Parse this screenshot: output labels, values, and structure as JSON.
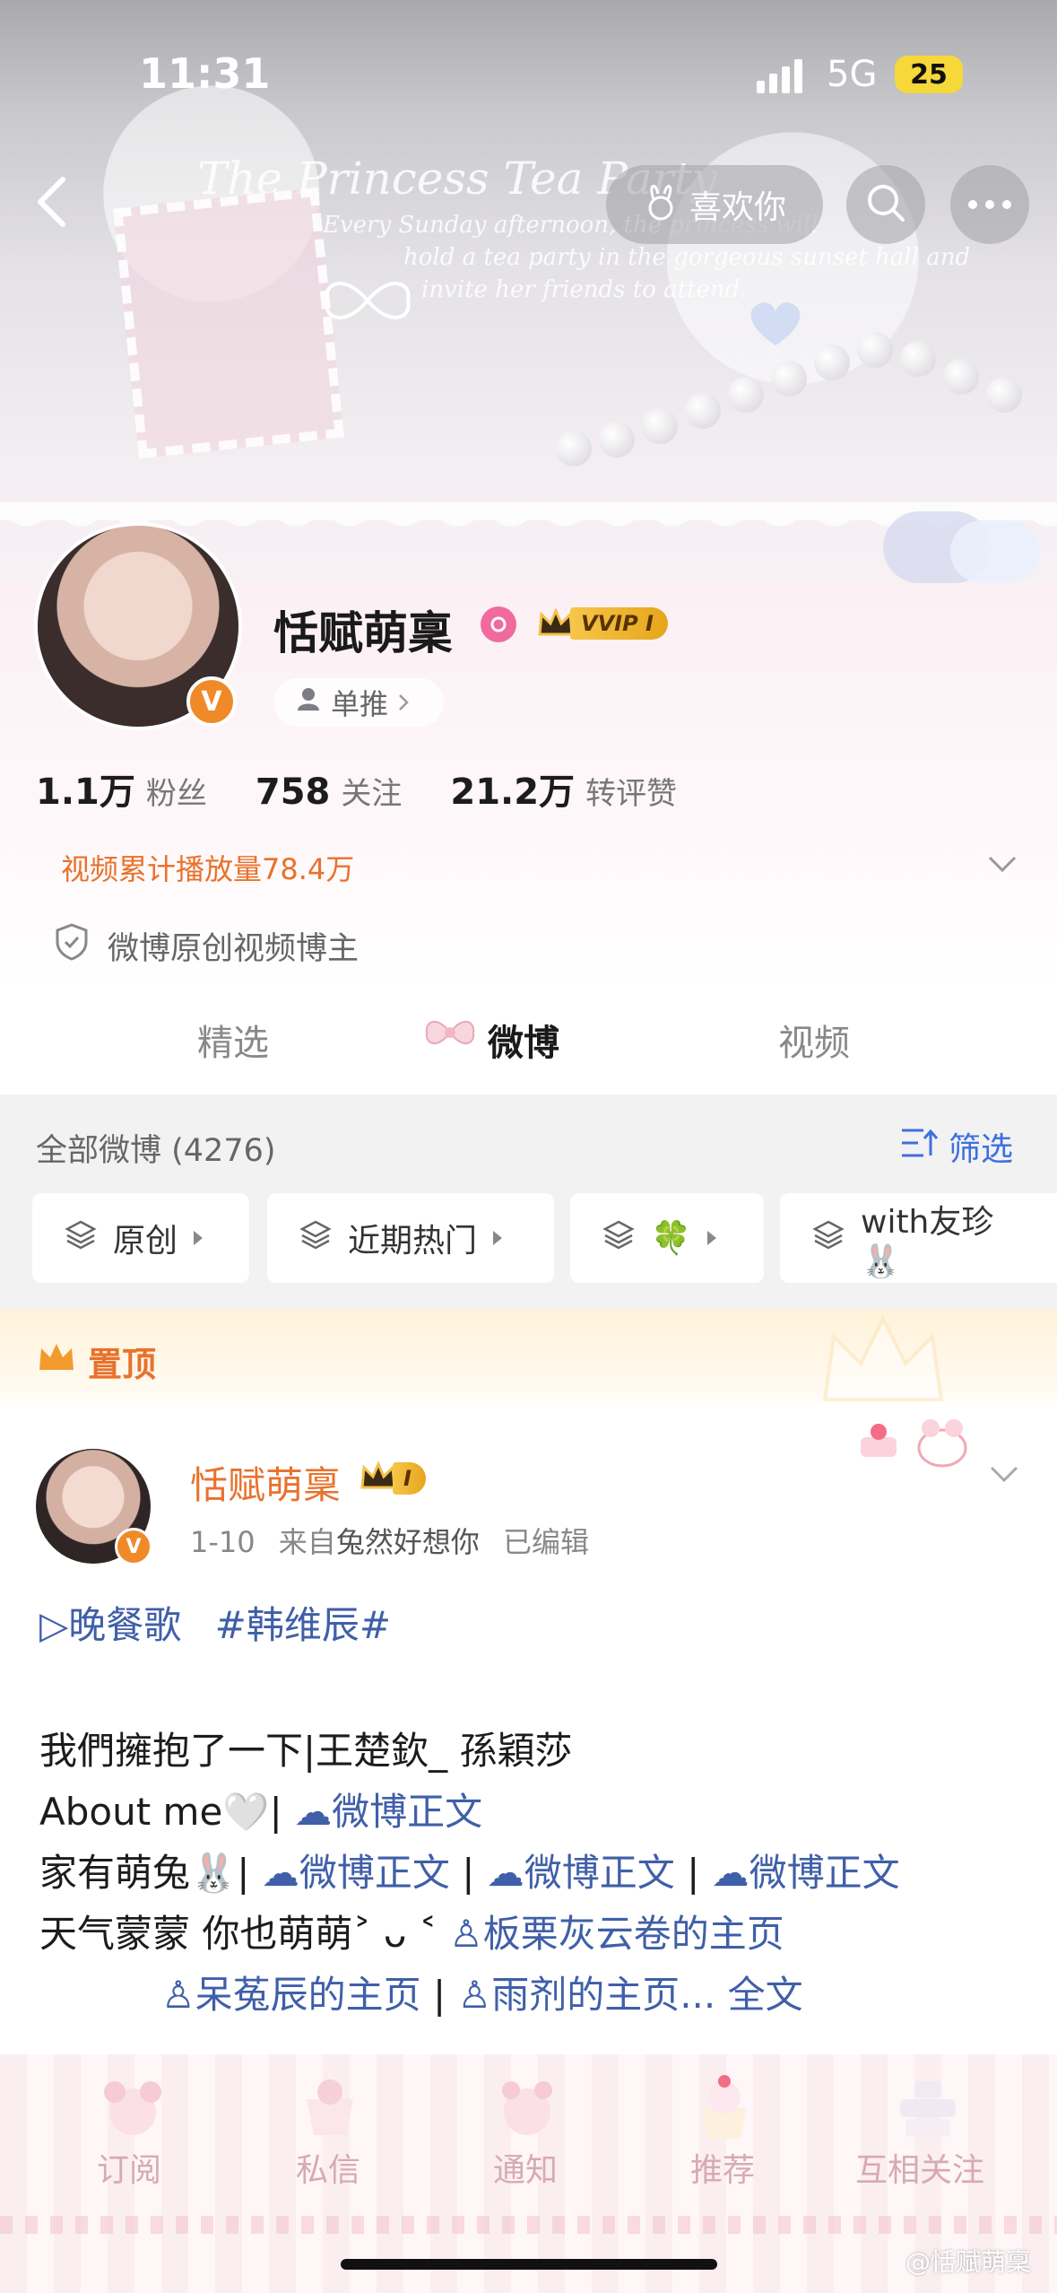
{
  "status_bar": {
    "time": "11:31",
    "network": "5G",
    "battery": "25"
  },
  "banner": {
    "title_line": "The Princess Tea Party",
    "lines": [
      "Every Sunday afternoon, the princess will",
      "hold a tea party in the gorgeous sunset hall and",
      "invite her friends to attend."
    ]
  },
  "nav": {
    "like_label": "喜欢你"
  },
  "profile": {
    "username": "恬赋萌稟",
    "vip_label": "VVIP I",
    "single_push": "单推",
    "stats": [
      {
        "num": "1.1万",
        "label": "粉丝"
      },
      {
        "num": "758",
        "label": "关注"
      },
      {
        "num": "21.2万",
        "label": "转评赞"
      }
    ],
    "video_plays": "视频累计播放量78.4万",
    "creator_label": "微博原创视频博主"
  },
  "tabs": [
    "精选",
    "微博",
    "视频"
  ],
  "filter": {
    "all_posts": "全部微博 (4276)",
    "filter_label": "筛选",
    "chips": [
      "原创",
      "近期热门",
      "🍀",
      "with友珍🐰"
    ]
  },
  "pinned": {
    "label": "置顶"
  },
  "post": {
    "author": "恬赋萌稟",
    "vip_label": "I",
    "date": "1-10",
    "source_prefix": "来自",
    "source": "兔然好想你",
    "edited": "已编辑",
    "topic1": "▷晚餐歌",
    "topic2": "#韩维辰#",
    "line1": "我們擁抱了一下|王楚欽_ 孫穎莎",
    "line2_text": "About me🤍|",
    "line2_link": "微博正文",
    "line3_text": "家有萌兔🐰|",
    "line3_links": [
      "微博正文",
      "微博正文",
      "微博正文"
    ],
    "line4_text": "天气蒙蒙 你也萌萌˃ ᴗ ˂",
    "line4_link": "板栗灰云卷的主页",
    "line5_link1": "呆菟辰的主页",
    "line5_link2": "雨剂的主页...",
    "line5_more": "全文"
  },
  "bottom_nav": [
    "订阅",
    "私信",
    "通知",
    "推荐",
    "互相关注"
  ],
  "watermark": "@恬赋萌稟",
  "colors": {
    "accent_orange": "#e8722c",
    "link_blue": "#3f5fa8",
    "filter_blue": "#3d6fe0"
  }
}
